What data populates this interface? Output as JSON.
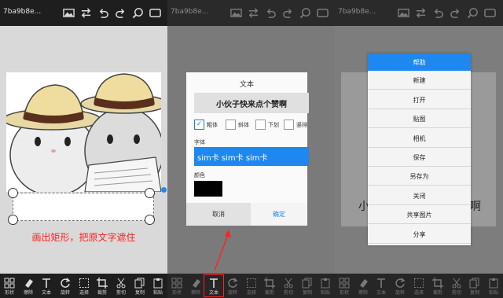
{
  "colors": {
    "accent": "#1e88f0",
    "annotation": "#ff2222",
    "bar": "#1e1e1e"
  },
  "panels": [
    {
      "filename": "7ba9b8e...",
      "caption": "画出矩形，把原文字遮住",
      "tools": [
        {
          "label": "形状",
          "icon": "grid-icon"
        },
        {
          "label": "擦除",
          "icon": "eraser-icon"
        },
        {
          "label": "文本",
          "icon": "text-icon"
        },
        {
          "label": "旋转",
          "icon": "rotate-icon"
        },
        {
          "label": "选择",
          "icon": "select-icon"
        },
        {
          "label": "裁剪",
          "icon": "crop-icon"
        },
        {
          "label": "剪切",
          "icon": "scissors-icon"
        },
        {
          "label": "复制",
          "icon": "copy-icon"
        },
        {
          "label": "粘贴",
          "icon": "paste-icon"
        }
      ]
    },
    {
      "filename": "7ba9b8e...",
      "tools": [
        {
          "label": "形状",
          "icon": "grid-icon"
        },
        {
          "label": "擦除",
          "icon": "eraser-icon"
        },
        {
          "label": "文本",
          "icon": "text-icon"
        },
        {
          "label": "旋转",
          "icon": "rotate-icon"
        },
        {
          "label": "选择",
          "icon": "select-icon"
        },
        {
          "label": "裁剪",
          "icon": "crop-icon"
        },
        {
          "label": "剪切",
          "icon": "scissors-icon"
        },
        {
          "label": "复制",
          "icon": "copy-icon"
        },
        {
          "label": "粘贴",
          "icon": "paste-icon"
        }
      ]
    },
    {
      "filename": "7ba9b8e...",
      "tools": [
        {
          "label": "形状",
          "icon": "grid-icon"
        },
        {
          "label": "擦除",
          "icon": "eraser-icon"
        },
        {
          "label": "文本",
          "icon": "text-icon"
        },
        {
          "label": "旋转",
          "icon": "rotate-icon"
        },
        {
          "label": "选择",
          "icon": "select-icon"
        },
        {
          "label": "裁剪",
          "icon": "crop-icon"
        },
        {
          "label": "剪切",
          "icon": "scissors-icon"
        },
        {
          "label": "复制",
          "icon": "copy-icon"
        },
        {
          "label": "粘贴",
          "icon": "paste-icon"
        }
      ]
    }
  ],
  "top_icons": [
    "image-icon",
    "swap-icon",
    "undo-icon",
    "redo-icon",
    "zoom-icon",
    "fullscreen-icon"
  ],
  "text_dialog": {
    "title": "文本",
    "text_value": "小伙子快来点个赞啊",
    "options": [
      {
        "label": "粗体",
        "checked": true
      },
      {
        "label": "斜体",
        "checked": false
      },
      {
        "label": "下划",
        "checked": false
      },
      {
        "label": "竖排",
        "checked": false
      }
    ],
    "font_label": "字体",
    "font_value": "sim卡  sim卡  sim卡",
    "color_label": "颜色",
    "color_value": "#000000",
    "cancel": "取消",
    "confirm": "确定"
  },
  "panel3_partial_text": "小",
  "panel3_partial_text_right": "啊",
  "menu": {
    "items": [
      {
        "label": "帮助",
        "highlighted": true
      },
      {
        "label": "新建"
      },
      {
        "label": "打开"
      },
      {
        "label": "贴图"
      },
      {
        "label": "相机"
      },
      {
        "label": "保存"
      },
      {
        "label": "另存为"
      },
      {
        "label": "关闭"
      },
      {
        "label": "共享图片"
      },
      {
        "label": "分享"
      }
    ]
  }
}
